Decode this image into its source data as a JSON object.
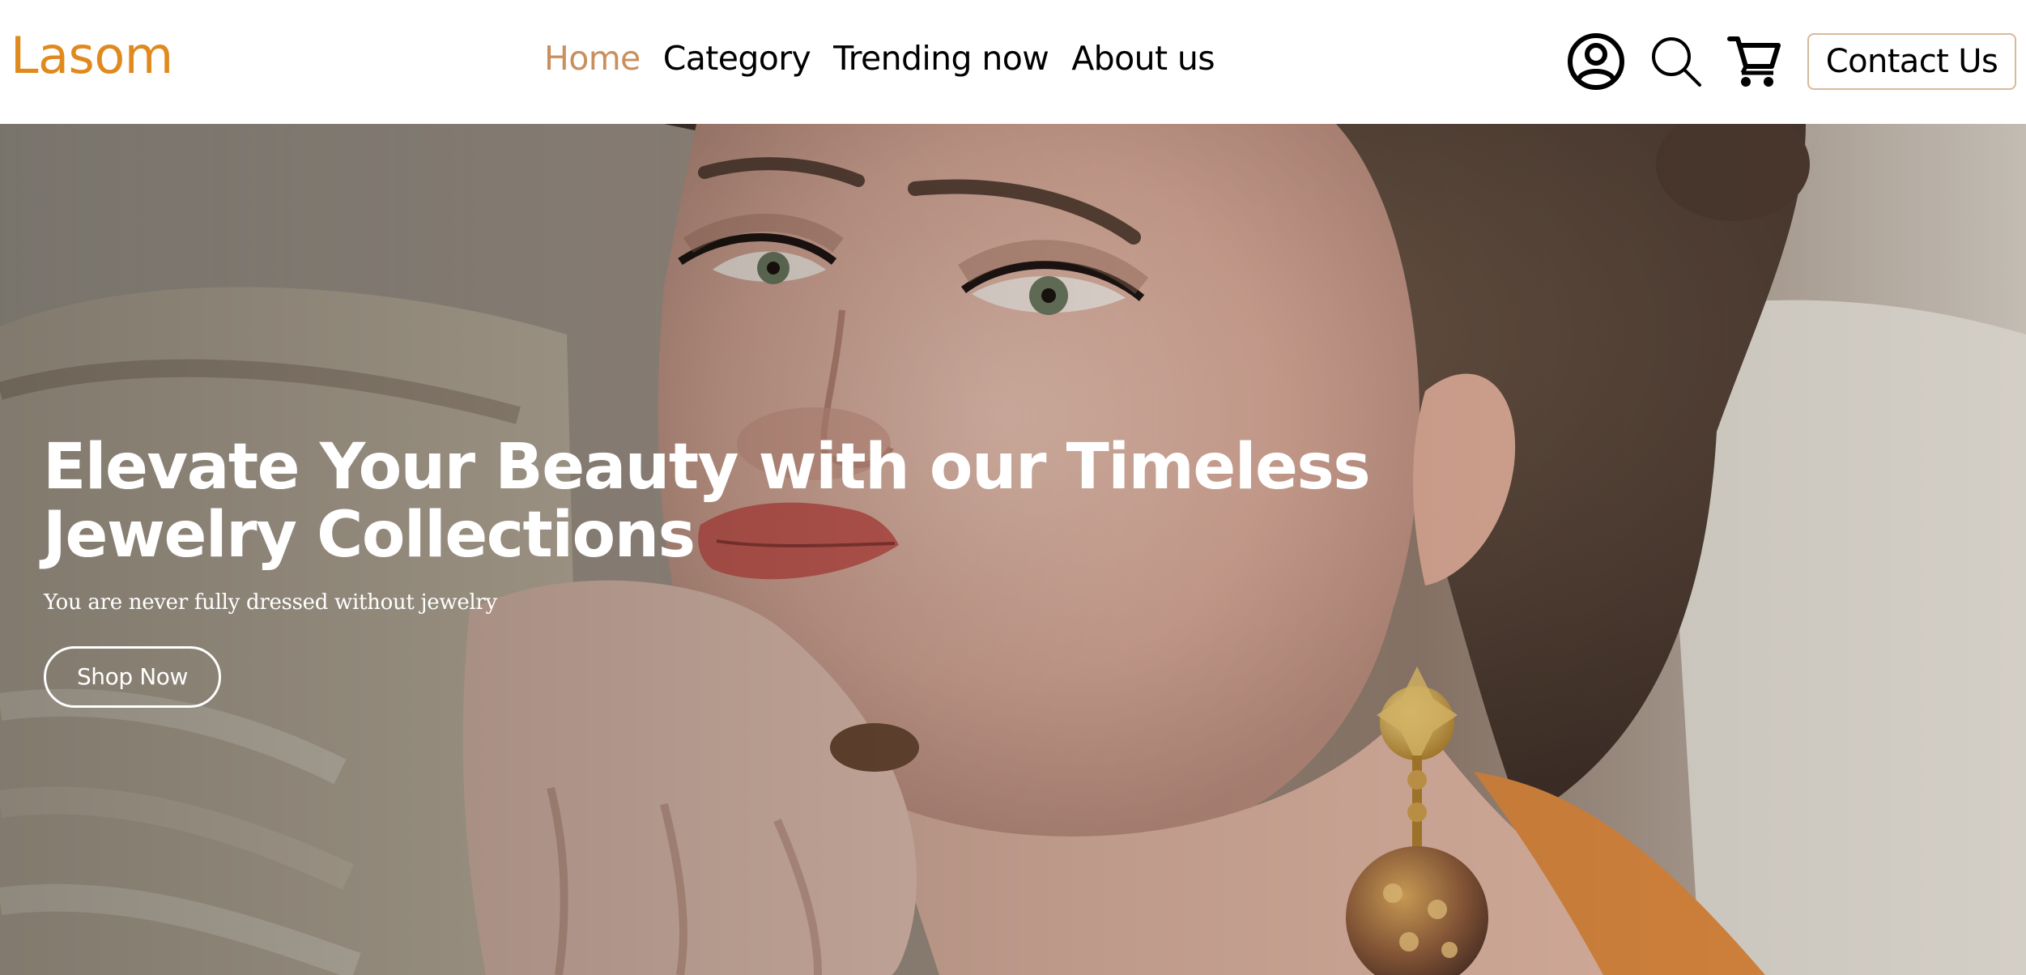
{
  "brand": {
    "name": "Lasom",
    "accent_color": "#e08a1e"
  },
  "nav": {
    "items": [
      {
        "label": "Home",
        "active": true
      },
      {
        "label": "Category",
        "active": false
      },
      {
        "label": "Trending now",
        "active": false
      },
      {
        "label": "About us",
        "active": false
      }
    ],
    "active_color": "#c98f5d",
    "default_color": "#000000"
  },
  "header_actions": {
    "icons": [
      "account-icon",
      "search-icon",
      "cart-icon"
    ],
    "contact_label": "Contact Us"
  },
  "hero": {
    "title_line1": "Elevate Your Beauty with our Timeless",
    "title_line2": "Jewelry Collections",
    "subtitle": "You are never fully dressed without jewelry",
    "cta_label": "Shop Now",
    "image": "woman-with-gold-earring-photo"
  }
}
